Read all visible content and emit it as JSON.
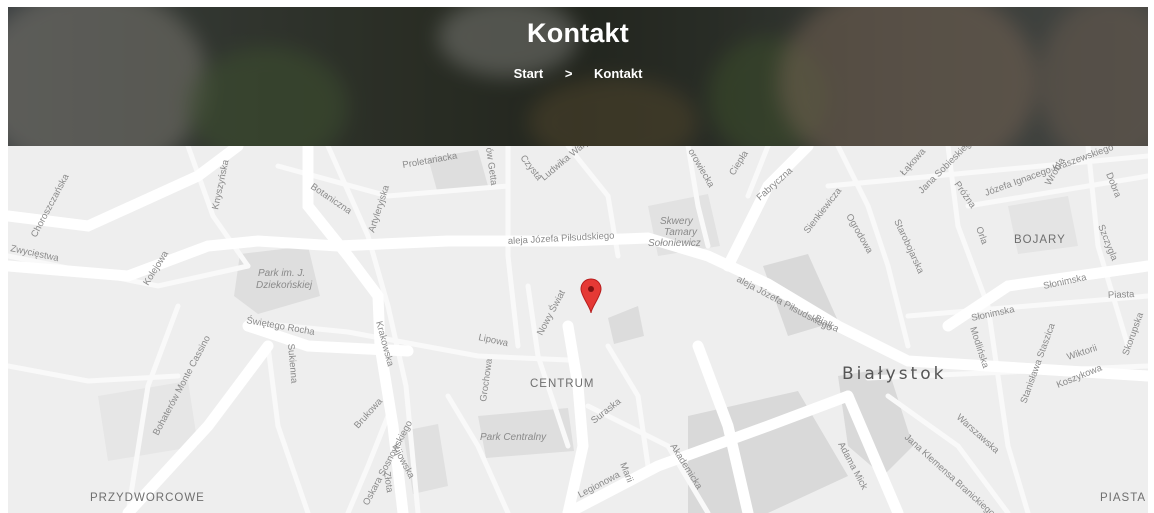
{
  "hero": {
    "title": "Kontakt",
    "breadcrumb": {
      "home_label": "Start",
      "separator": ">",
      "current_label": "Kontakt"
    }
  },
  "map": {
    "marker_color": "#e53935",
    "city_label": "Białystok",
    "districts": {
      "centrum": "CENTRUM",
      "bojary": "BOJARY",
      "przydworcowe": "PRZYDWORCOWE",
      "piasta": "PIASTA"
    },
    "parks": {
      "park_dziekonskiej_line1": "Park im. J.",
      "park_dziekonskiej_line2": "Dziekońskiej",
      "skwery_line1": "Skwery",
      "skwery_line2": "Tamary",
      "skwery_line3": "Sołoniewicz",
      "park_centralny": "Park Centralny"
    },
    "streets": {
      "proletariacka": "Proletariacka",
      "czysta": "Czysta",
      "warynskiego": "Ludwika Waryńskiego",
      "ofiar_getta": "ów Getta",
      "orzeszkowej": "orowiecka",
      "ciepla": "Ciepła",
      "fabryczna": "Fabryczna",
      "sienkiewicza": "Sienkiewicza",
      "lakowa": "Łąkowa",
      "sobieskiego": "Jana Sobieskiego",
      "prozna": "Próżna",
      "kraszewskiego": "Józefa Ignacego Kraszewskiego",
      "wrobla": "Wróbla",
      "dobra": "Dobra",
      "poleska": "Szczygla",
      "ogrodowa": "Ogrodowa",
      "starobojarska": "Starobojarska",
      "orla": "Orla",
      "chorosczanska": "Choroszczańska",
      "zwyciestwa": "Zwycięstwa",
      "kolejowa": "Kolejowa",
      "botaniczna": "Botaniczna",
      "artyleryjska": "Artyleryjska",
      "knyszynska": "Knyszyńska",
      "pilsudskiego_1": "aleja Józefa Piłsudskiego",
      "pilsudskiego_2": "aleja Józefa Piłsudskiego",
      "nowy_swiat": "Nowy Świat",
      "swietego_rocha": "Świętego Rocha",
      "lipowa": "Lipowa",
      "krakowska": "Krakowska",
      "sukienna": "Sukienna",
      "grochowa": "Grochowa",
      "bialka": "Białka",
      "slonimska_1": "Słonimska",
      "slonimska_2": "Słonimska",
      "piasta_st": "Piasta",
      "modlinska": "Modlińska",
      "staszica": "Stanisława Staszica",
      "wiktorii": "Wiktorii",
      "skorupska": "Skorupska",
      "koszykowa": "Koszykowa",
      "warszawska": "Warszawska",
      "branickiego": "Jana Klemensa Branickiego",
      "adama_mickiewicza": "Adama Mick",
      "akademicka": "Akademicka",
      "marii": "Marii",
      "legionowa": "Legionowa",
      "surazska": "Suraska",
      "brukowa": "Brukowa",
      "kijowska": "Kijowska",
      "sosnowskiego": "Oskara Sosnowskiego",
      "zlota": "Złota",
      "bohaterow": "Bohaterów Monte Cassino"
    }
  }
}
